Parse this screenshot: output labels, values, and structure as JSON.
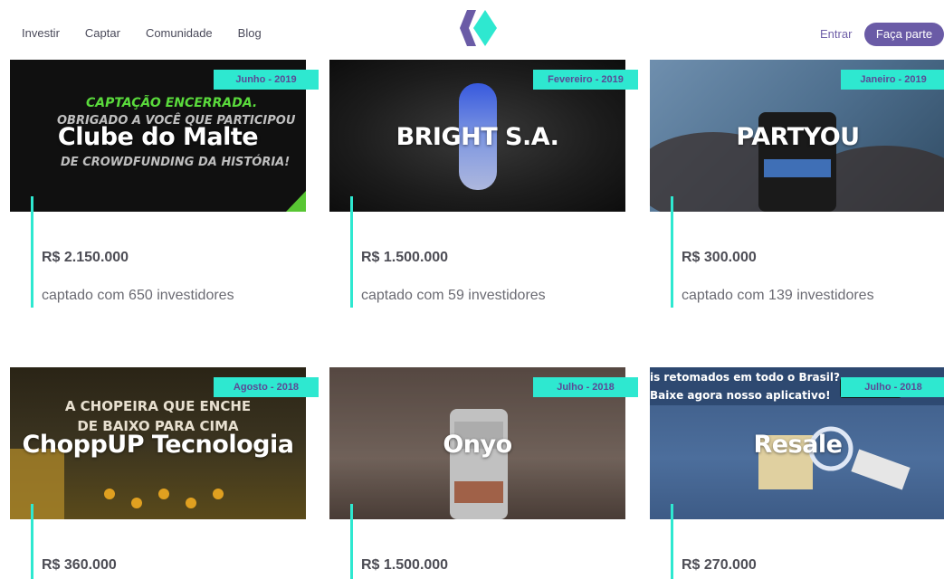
{
  "nav": {
    "items": [
      "Investir",
      "Captar",
      "Comunidade",
      "Blog"
    ],
    "signin_label": "Entrar",
    "join_label": "Faça parte"
  },
  "colors": {
    "accent": "#2ee8d0",
    "brand": "#6a5ba6"
  },
  "cards": [
    {
      "name": "Clube do Malte",
      "date": "Junho - 2019",
      "amount": "R$ 2.150.000",
      "investors": "captado com 650 investidores",
      "cover_text": [
        "CAPTAÇÃO ENCERRADA.",
        "OBRIGADO A VOCÊ QUE PARTICIPOU",
        "DE CROWDFUNDING DA HISTÓRIA!"
      ]
    },
    {
      "name": "BRIGHT S.A.",
      "date": "Fevereiro - 2019",
      "amount": "R$ 1.500.000",
      "investors": "captado com 59 investidores"
    },
    {
      "name": "PARTYOU",
      "date": "Janeiro - 2019",
      "amount": "R$ 300.000",
      "investors": "captado com 139 investidores"
    },
    {
      "name": "ChoppUP Tecnologia",
      "date": "Agosto - 2018",
      "amount": "R$ 360.000",
      "cover_text": [
        "A CHOPEIRA QUE ENCHE",
        "DE BAIXO PARA CIMA"
      ]
    },
    {
      "name": "Onyo",
      "date": "Julho - 2018",
      "amount": "R$ 1.500.000"
    },
    {
      "name": "Resale",
      "date": "Julho - 2018",
      "amount": "R$ 270.000",
      "cover_text": [
        "is retomados em todo o Brasil?",
        "Baixe agora nosso aplicativo!"
      ]
    }
  ]
}
